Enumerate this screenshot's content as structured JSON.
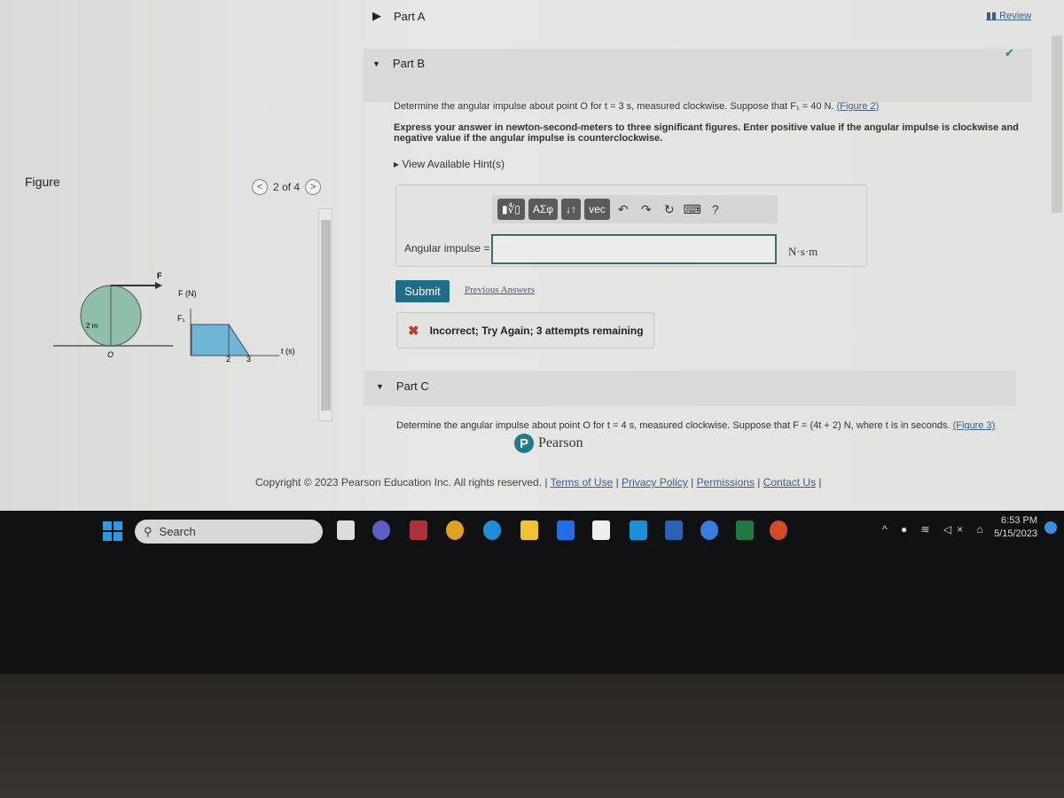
{
  "figure_panel": {
    "title": "Figure",
    "pager": "2 of 4",
    "labels": {
      "force": "F",
      "radius": "2 m",
      "point": "O",
      "y_axis": "F (N)",
      "f1": "F₁",
      "t2": "2",
      "t3": "3",
      "x_axis": "t (s)"
    }
  },
  "header": {
    "review": "Review"
  },
  "part_a": {
    "label": "Part A"
  },
  "part_b": {
    "label": "Part B",
    "question": "Determine the angular impulse about point O for t = 3 s, measured clockwise. Suppose that F₁ = 40 N.",
    "figure_link": "(Figure 2)",
    "instructions": "Express your answer in newton-second-meters to three significant figures. Enter positive value if the angular impulse is clockwise and negative value if the angular impulse is counterclockwise.",
    "hints": "View Available Hint(s)",
    "toolbar": {
      "templates": "▮∜▯",
      "greek": "ΑΣφ",
      "sort": "↓↑",
      "vec": "vec",
      "help": "?"
    },
    "answer_label": "Angular impulse =",
    "answer_value": "",
    "units": "N·s·m",
    "submit": "Submit",
    "previous_answers": "Previous Answers",
    "feedback": "Incorrect; Try Again; 3 attempts remaining"
  },
  "part_c": {
    "label": "Part C",
    "question": "Determine the angular impulse about point O for t = 4 s, measured clockwise. Suppose that F = (4t + 2) N, where t is in seconds.",
    "figure_link": "(Figure 3)"
  },
  "brand": "Pearson",
  "footer": {
    "copyright": "Copyright © 2023 Pearson Education Inc. All rights reserved. |",
    "links": [
      "Terms of Use",
      "Privacy Policy",
      "Permissions",
      "Contact Us"
    ]
  },
  "taskbar": {
    "search": "Search",
    "time": "6:53 PM",
    "date": "5/15/2023"
  },
  "colors": {
    "submit": "#1e6d8a",
    "error": "#c0392b",
    "figure_fill": "#8fbfa8",
    "graph_fill": "#6fb6d6"
  }
}
